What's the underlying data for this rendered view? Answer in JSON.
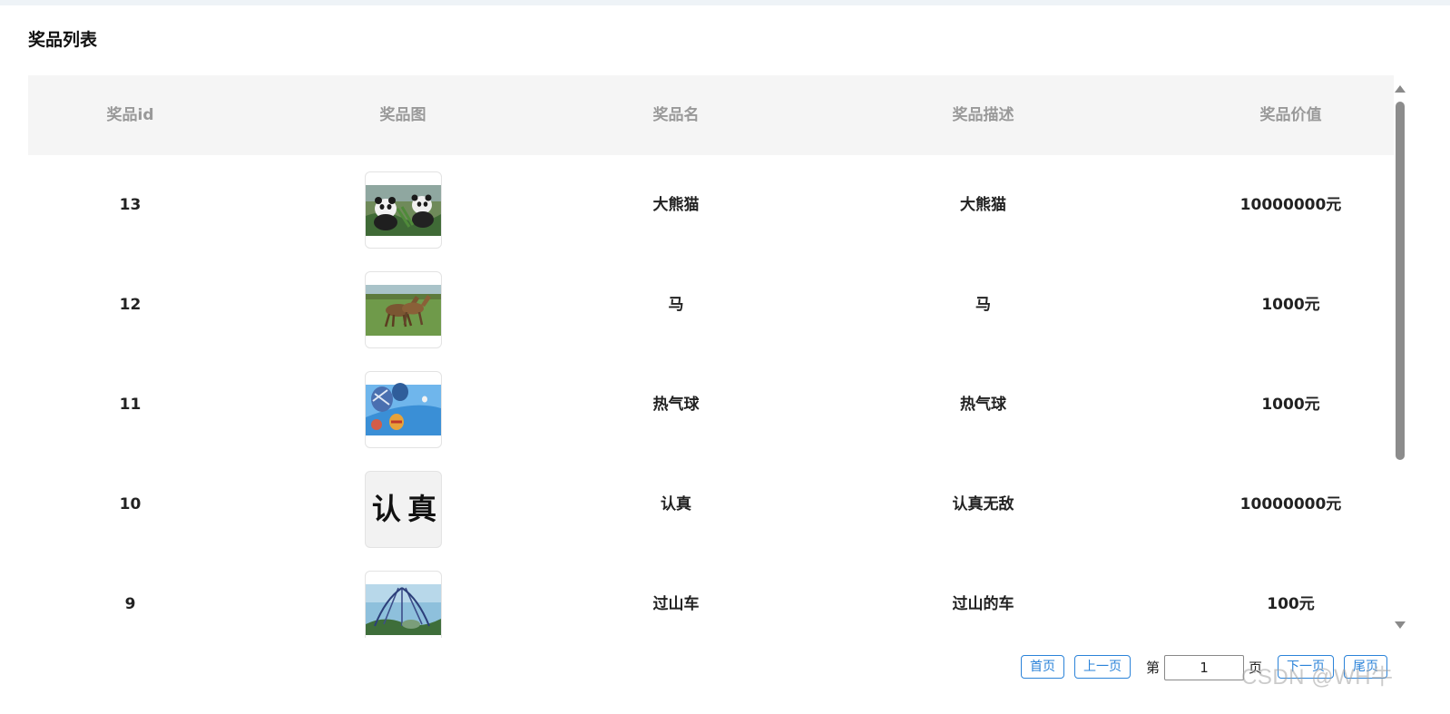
{
  "page": {
    "title": "奖品列表"
  },
  "table": {
    "headers": [
      "奖品id",
      "奖品图",
      "奖品名",
      "奖品描述",
      "奖品价值"
    ],
    "rows": [
      {
        "id": "13",
        "image": "panda-image",
        "name": "大熊猫",
        "desc": "大熊猫",
        "value": "10000000元"
      },
      {
        "id": "12",
        "image": "horses-image",
        "name": "马",
        "desc": "马",
        "value": "1000元"
      },
      {
        "id": "11",
        "image": "hot-air-balloon-image",
        "name": "热气球",
        "desc": "热气球",
        "value": "1000元"
      },
      {
        "id": "10",
        "image": "calligraphy-image",
        "name": "认真",
        "desc": "认真无敌",
        "value": "10000000元"
      },
      {
        "id": "9",
        "image": "roller-coaster-image",
        "name": "过山车",
        "desc": "过山的车",
        "value": "100元"
      }
    ],
    "calligraphy_text": "认 真"
  },
  "pagination": {
    "first": "首页",
    "prev": "上一页",
    "page_prefix": "第",
    "page_value": "1",
    "page_suffix": "页",
    "next": "下一页",
    "last": "尾页"
  },
  "watermark": "CSDN @WH牛",
  "colors": {
    "accent": "#2b83d9",
    "header_bg": "#f5f5f5",
    "header_text": "#999999"
  }
}
